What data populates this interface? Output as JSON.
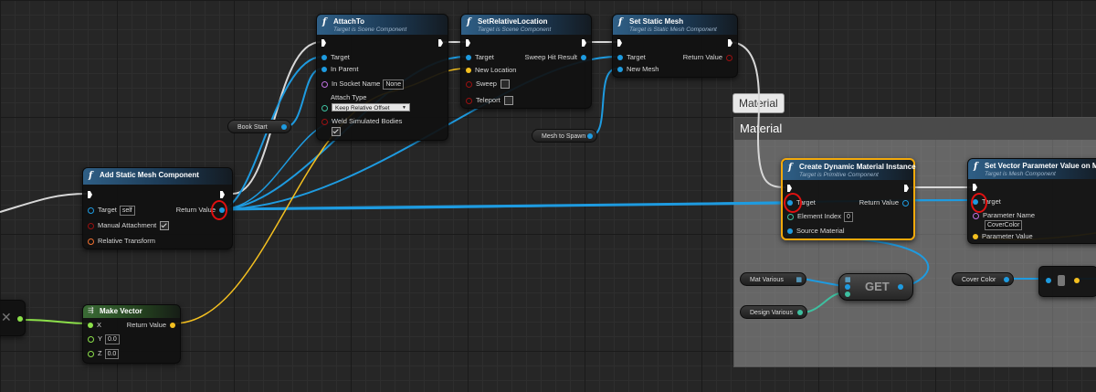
{
  "colors": {
    "object_pin": "#1e9be0",
    "vector_pin": "#f4c020",
    "name_pin": "#c070e0",
    "bool_pin": "#9a1010",
    "transform_pin": "#f07030",
    "float_pin": "#8ce04a",
    "wire_exec": "#e0e0e0",
    "wire_object": "#1e9be0",
    "wire_vector": "#f4c020",
    "wire_float": "#8ce04a",
    "selection": "#f2a90a"
  },
  "comment": {
    "tab_label": "Material",
    "title": "Material"
  },
  "nodes": {
    "attach_to": {
      "icon": "f",
      "title": "AttachTo",
      "subtitle": "Target is Scene Component",
      "target": "Target",
      "in_parent": "In Parent",
      "socket_label": "In Socket Name",
      "socket_value": "None",
      "attach_type_label": "Attach Type",
      "attach_type_value": "Keep Relative Offset",
      "weld_label": "Weld Simulated Bodies"
    },
    "set_relative_location": {
      "icon": "f",
      "title": "SetRelativeLocation",
      "subtitle": "Target is Scene Component",
      "target": "Target",
      "new_location": "New Location",
      "sweep": "Sweep",
      "teleport": "Teleport",
      "sweep_hit": "Sweep Hit Result"
    },
    "set_static_mesh": {
      "icon": "f",
      "title": "Set Static Mesh",
      "subtitle": "Target is Static Mesh Component",
      "target": "Target",
      "new_mesh": "New Mesh",
      "return_value": "Return Value"
    },
    "add_static_mesh": {
      "icon": "f",
      "title": "Add Static Mesh Component",
      "target": "Target",
      "target_value": "self",
      "manual_attachment": "Manual Attachment",
      "relative_transform": "Relative Transform",
      "return_value": "Return Value"
    },
    "make_vector": {
      "title": "Make Vector",
      "x": "X",
      "y": "Y",
      "y_value": "0.0",
      "z": "Z",
      "z_value": "0.0",
      "return_value": "Return Value"
    },
    "create_dmi": {
      "icon": "f",
      "title": "Create Dynamic Material Instance",
      "subtitle": "Target is Primitive Component",
      "target": "Target",
      "element_index": "Element Index",
      "element_index_value": "0",
      "source_material": "Source Material",
      "return_value": "Return Value"
    },
    "set_vector_param": {
      "icon": "f",
      "title": "Set Vector Parameter Value on Materia",
      "subtitle": "Target is Mesh Component",
      "target": "Target",
      "parameter_name": "Parameter Name",
      "parameter_name_value": "CoverColor",
      "parameter_value": "Parameter Value"
    },
    "get": {
      "label": "GET"
    }
  },
  "variables": {
    "book_start": "Book Start",
    "mesh_to_spawn": "Mesh to Spawn",
    "mat_various": "Mat Various",
    "design_various": "Design Various",
    "cover_color": "Cover Color"
  }
}
